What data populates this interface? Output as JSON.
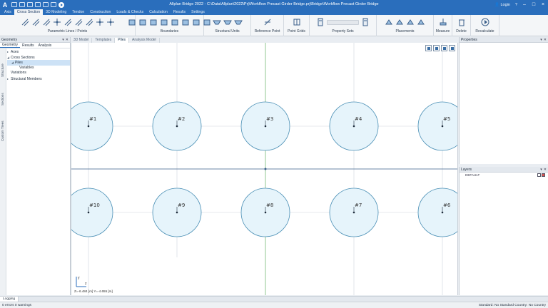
{
  "app": {
    "logo": "A",
    "title": "Allplan Bridge 2022 - C:\\Data\\Allplan\\2022\\Prj\\Workflow Precast Girder Bridge.prj\\Bridge\\Workflow Precast Girder Bridge",
    "login": "Login",
    "help": "?"
  },
  "menu": {
    "tabs": [
      "Axis",
      "Cross Section",
      "3D Modeling",
      "Tendon",
      "Construction",
      "Loads & Checks",
      "Calculation",
      "Results",
      "Settings"
    ],
    "active": "Cross Section"
  },
  "ribbon": {
    "groups": [
      {
        "label": "Parametric Lines / Points",
        "icons": [
          "line-icon",
          "line-icon",
          "line-icon",
          "point-icon",
          "line-icon",
          "line-icon",
          "line-icon",
          "point-icon",
          "point-icon"
        ]
      },
      {
        "label": "Boundaries",
        "icons": [
          "boundary-icon",
          "boundary-icon",
          "boundary-icon",
          "boundary-icon",
          "boundary-icon",
          "boundary-icon",
          "boundary-icon",
          "boundary-icon"
        ]
      },
      {
        "label": "Structural Units",
        "icons": [
          "unit-icon",
          "unit-icon",
          "unit-icon"
        ]
      },
      {
        "label": "Reference Point",
        "icons": [
          "reference-point-icon"
        ]
      },
      {
        "label": "Point Grids",
        "icons": [
          "grid-icon"
        ]
      },
      {
        "label": "Property Sets",
        "icons": [
          "property-icon",
          "property-icon"
        ]
      },
      {
        "label": "Placements",
        "icons": [
          "placement-icon",
          "placement-icon",
          "placement-icon",
          "placement-icon"
        ]
      },
      {
        "label": "Measure",
        "icons": [
          "measure-icon"
        ]
      },
      {
        "label": "Delete",
        "icons": [
          "delete-icon"
        ]
      },
      {
        "label": "Recalculate",
        "icons": [
          "recalculate-icon"
        ]
      }
    ]
  },
  "left_panel": {
    "title": "Geometry",
    "tabs": [
      "Geometry",
      "Results",
      "Analysis"
    ],
    "vertical_tabs": [
      "Structure",
      "Sections",
      "Custom Trees"
    ],
    "tree": [
      {
        "label": "Axes",
        "level": 0,
        "arrow": "▸",
        "selected": false
      },
      {
        "label": "Cross Sections",
        "level": 0,
        "arrow": "◢",
        "selected": false
      },
      {
        "label": "Piles",
        "level": 1,
        "arrow": "◢",
        "selected": true
      },
      {
        "label": "Variables",
        "level": 2,
        "arrow": "",
        "selected": false
      },
      {
        "label": "Variations",
        "level": 0,
        "arrow": "",
        "selected": false
      },
      {
        "label": "Structural Members",
        "level": 0,
        "arrow": "▸",
        "selected": false
      }
    ]
  },
  "view_tabs": {
    "items": [
      "3D Model",
      "Templates",
      "Piles",
      "Analysis Model"
    ],
    "active": "Piles"
  },
  "canvas": {
    "piles_top": [
      "#1",
      "#2",
      "#3",
      "#4",
      "#5"
    ],
    "piles_bottom": [
      "#10",
      "#9",
      "#8",
      "#7",
      "#6"
    ],
    "coordinates": "Z=-6.484 [m] Y=-4.655 [m]",
    "axis_y": "y",
    "axis_z": "z"
  },
  "right_panel": {
    "properties_title": "Properties",
    "layers_title": "Layers",
    "layers": [
      "DEFAULT"
    ]
  },
  "bottom": {
    "log_tab": "Logging",
    "status_left": "0 errors 0 warnings",
    "status_right": "Standard: No Standard Country: No Country"
  },
  "colors": {
    "accent": "#2a6ebc",
    "pile_fill": "#e6f4fb",
    "pile_stroke": "#4a8fb5",
    "axis_line": "#7cbf7c",
    "grid_line": "#cfd6dd"
  }
}
